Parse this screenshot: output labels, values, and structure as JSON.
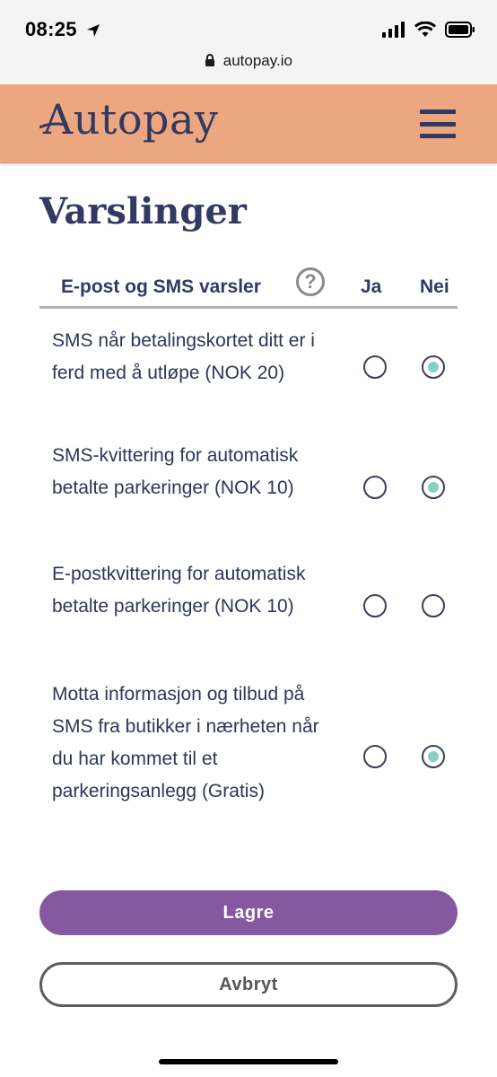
{
  "status_bar": {
    "time": "08:25",
    "icons": [
      "location-arrow-icon",
      "signal-icon",
      "wifi-icon",
      "battery-icon"
    ]
  },
  "browser": {
    "url": "autopay.io"
  },
  "header": {
    "logo_text": "Autopay",
    "menu_icon": "hamburger-menu-icon"
  },
  "page": {
    "title": "Varslinger"
  },
  "table": {
    "header_label": "E-post og SMS varsler",
    "help_symbol": "?",
    "col_yes": "Ja",
    "col_no": "Nei",
    "rows": [
      {
        "label": "SMS når betalingskortet ditt er i ferd med å utløpe (NOK 20)",
        "selected": "nei"
      },
      {
        "label": "SMS-kvittering for automatisk betalte parkeringer (NOK 10)",
        "selected": "nei"
      },
      {
        "label": "E-postkvittering for automatisk betalte parkeringer (NOK 10)",
        "selected": "none"
      },
      {
        "label": "Motta informasjon og tilbud på SMS fra butikker i nærheten når du har kommet til et parkeringsanlegg (Gratis)",
        "selected": "nei"
      }
    ]
  },
  "actions": {
    "save_label": "Lagre",
    "cancel_label": "Avbryt"
  },
  "colors": {
    "header_bg": "#eca680",
    "brand_navy": "#323963",
    "primary_button": "#8559a0",
    "radio_dot": "#86cfc4"
  }
}
